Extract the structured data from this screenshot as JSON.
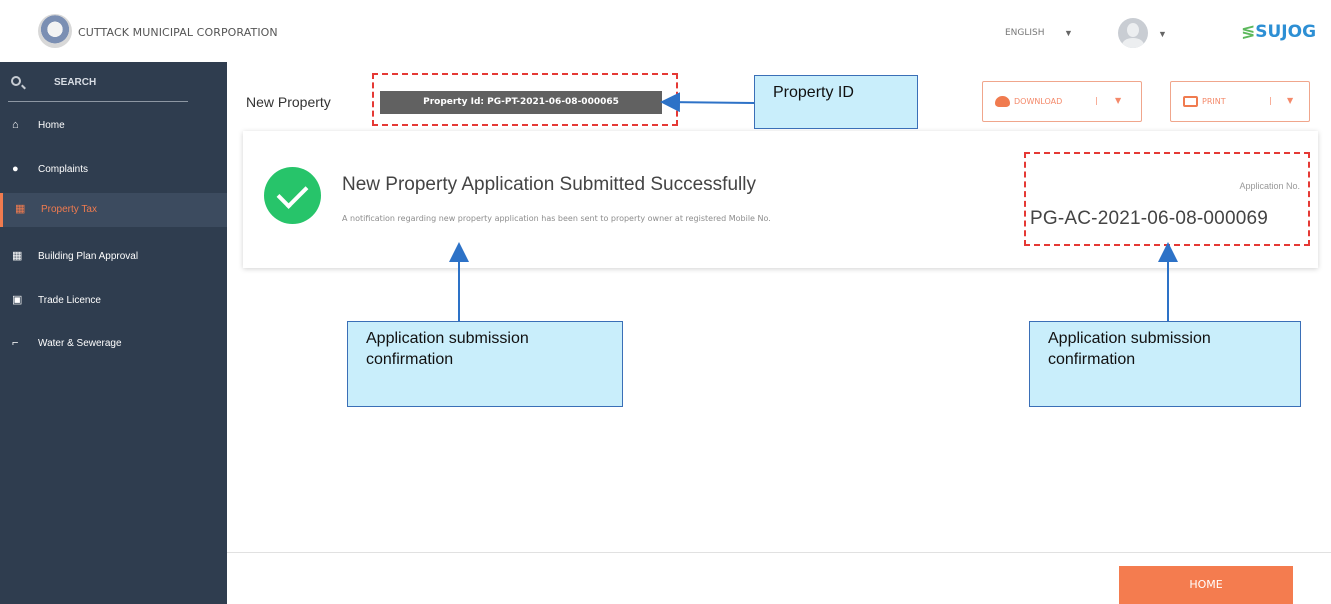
{
  "header": {
    "org_name": "CUTTACK MUNICIPAL CORPORATION",
    "language": "ENGLISH",
    "brand": "SUJOG",
    "brand_mark": "≶"
  },
  "sidebar": {
    "search_label": "SEARCH",
    "items": [
      {
        "label": "Home",
        "icon": "home-icon"
      },
      {
        "label": "Complaints",
        "icon": "user-group-icon"
      },
      {
        "label": "Property Tax",
        "icon": "building-icon",
        "active": true
      },
      {
        "label": "Building Plan Approval",
        "icon": "building-icon"
      },
      {
        "label": "Trade Licence",
        "icon": "briefcase-icon"
      },
      {
        "label": "Water & Sewerage",
        "icon": "water-tap-icon"
      }
    ]
  },
  "page": {
    "title": "New Property",
    "property_id_badge": "Property Id: PG-PT-2021-06-08-000065"
  },
  "actions": {
    "download_label": "DOWNLOAD",
    "print_label": "PRINT"
  },
  "confirmation": {
    "title": "New Property Application Submitted Successfully",
    "note": "A notification regarding new property application has been sent to property owner at registered Mobile No.",
    "application_label": "Application No.",
    "application_no": "PG-AC-2021-06-08-000069"
  },
  "footer": {
    "home_label": "HOME"
  },
  "annotations": {
    "property_id": "Property ID",
    "application_confirmation_left": "Application submission confirmation",
    "application_confirmation_right": "Application submission confirmation"
  },
  "colors": {
    "sidebar": "#2f3d4f",
    "accent": "#f47c4f",
    "success": "#27c46a",
    "annotation_fill": "#c9eefb",
    "annotation_border": "#3a6fb7",
    "dash_highlight": "#e53935"
  }
}
